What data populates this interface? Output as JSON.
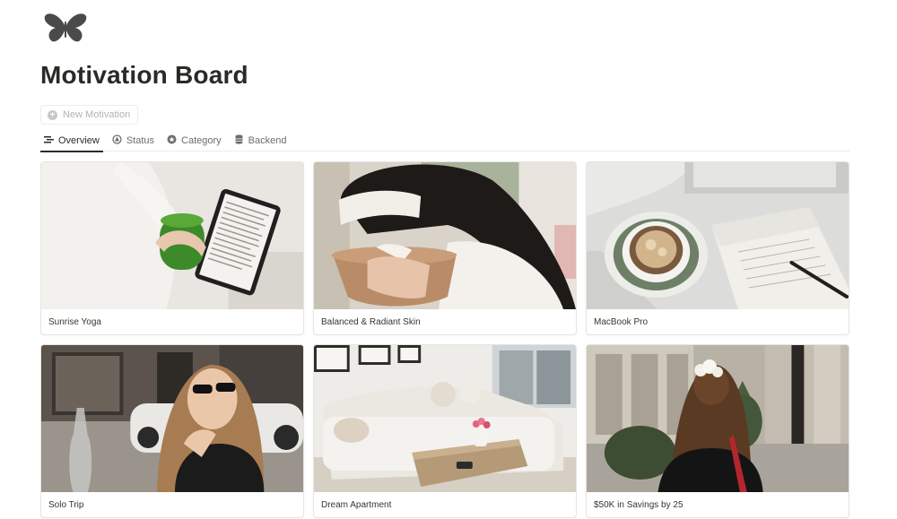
{
  "page": {
    "logo_icon": "butterfly-icon",
    "title": "Motivation Board"
  },
  "toolbar": {
    "new_label": "New Motivation",
    "new_icon": "plus-circle-icon"
  },
  "tabs": [
    {
      "label": "Overview",
      "icon": "list-icon",
      "active": true
    },
    {
      "label": "Status",
      "icon": "status-icon",
      "active": false
    },
    {
      "label": "Category",
      "icon": "category-icon",
      "active": false
    },
    {
      "label": "Backend",
      "icon": "database-icon",
      "active": false
    }
  ],
  "cards": [
    {
      "title": "Sunrise Yoga"
    },
    {
      "title": "Balanced & Radiant Skin"
    },
    {
      "title": "MacBook Pro"
    },
    {
      "title": "Solo Trip"
    },
    {
      "title": "Dream Apartment"
    },
    {
      "title": "$50K in Savings by 25"
    }
  ],
  "colors": {
    "text": "#37352f",
    "title": "#2b2a27",
    "border": "#e6e5e2"
  }
}
